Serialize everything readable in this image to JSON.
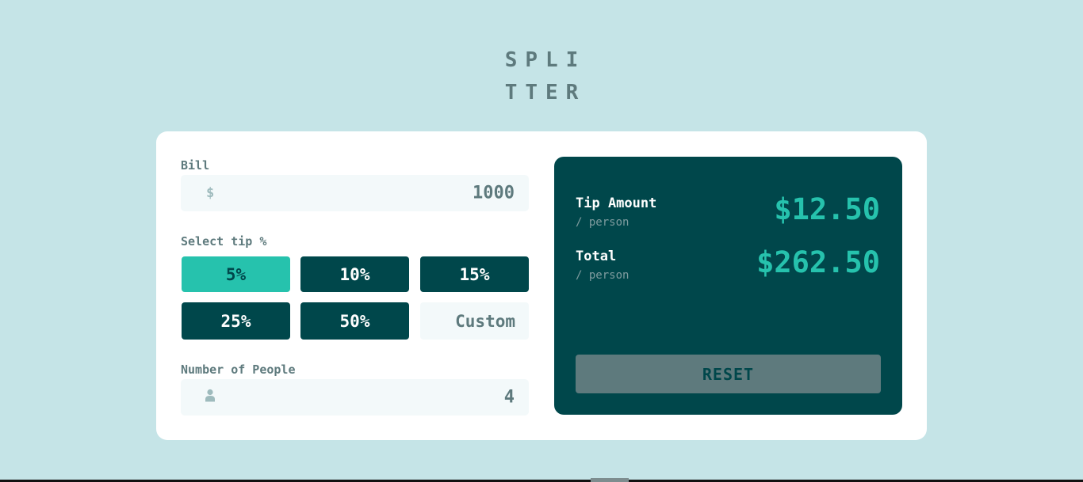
{
  "logo": {
    "line1": "SPLI",
    "line2": "TTER"
  },
  "bill": {
    "label": "Bill",
    "currency_symbol": "$",
    "value": "1000"
  },
  "tip": {
    "label": "Select tip %",
    "options": [
      "5%",
      "10%",
      "15%",
      "25%",
      "50%"
    ],
    "selected": "5%",
    "custom_placeholder": "Custom"
  },
  "people": {
    "label": "Number of People",
    "value": "4"
  },
  "results": {
    "tip_amount": {
      "title": "Tip Amount",
      "sub": "/ person",
      "value": "$12.50"
    },
    "total": {
      "title": "Total",
      "sub": "/ person",
      "value": "$262.50"
    },
    "reset_label": "RESET"
  },
  "colors": {
    "background": "#c5e4e7",
    "dark_cyan": "#00474b",
    "strong_cyan": "#26c2ad",
    "grayish_cyan": "#5e7a7d",
    "light_cyan": "#f3f9fa"
  }
}
